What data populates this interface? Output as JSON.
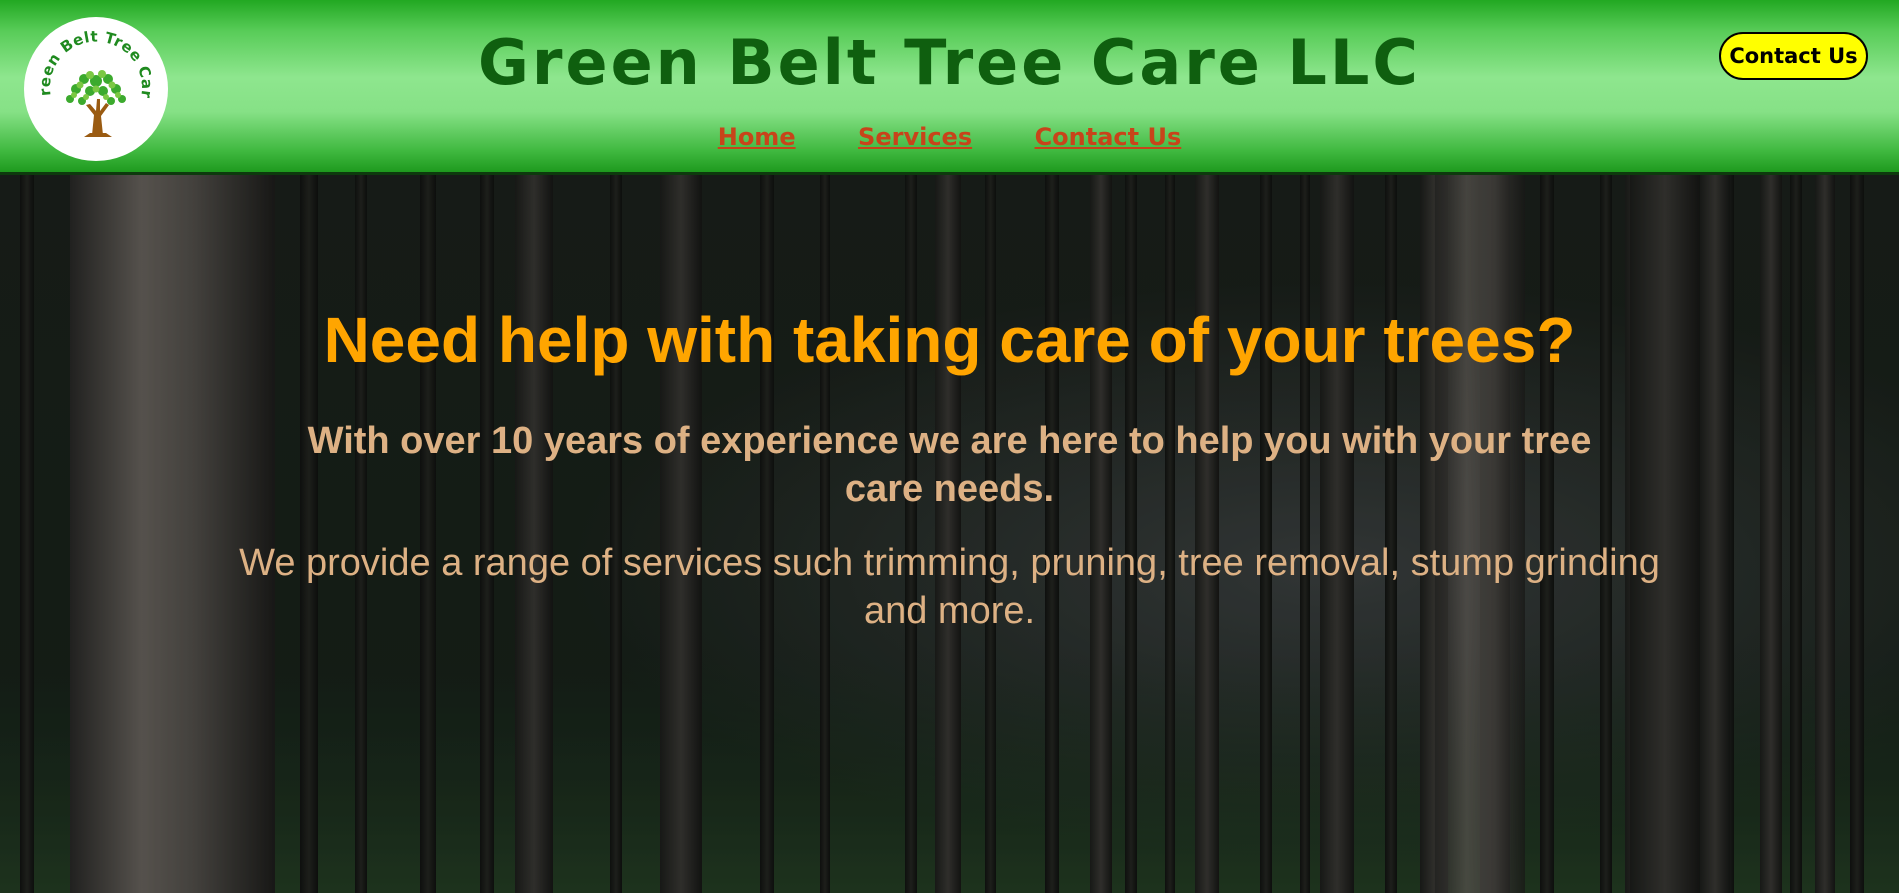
{
  "header": {
    "logo": {
      "text": "Green Belt Tree Care",
      "icon": "tree-icon"
    },
    "title": "Green Belt Tree Care LLC",
    "nav": [
      {
        "label": "Home"
      },
      {
        "label": "Services"
      },
      {
        "label": "Contact Us"
      }
    ],
    "contact_button": "Contact Us"
  },
  "hero": {
    "background": "forest-photo",
    "heading": "Need help with taking care of your trees?",
    "subheading": "With over 10 years of experience we are here to help you with your tree care needs.",
    "text": "We provide a range of services such trimming, pruning, tree removal, stump grinding and more."
  },
  "colors": {
    "header_green": "#8ee68e",
    "title_green": "#0f5f0f",
    "nav_link": "#c8441a",
    "button_yellow": "#ffff00",
    "heading_orange": "#ffa500",
    "body_tan": "#ddb184"
  }
}
